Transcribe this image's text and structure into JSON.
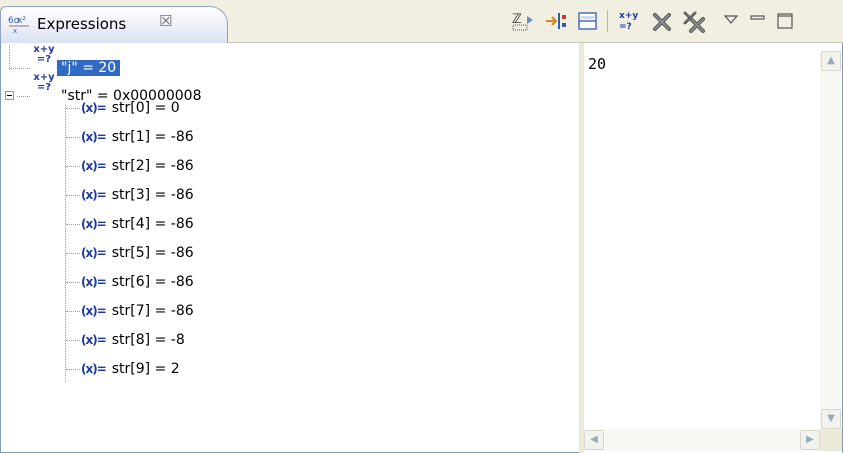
{
  "view": {
    "title": "Expressions",
    "close_glyph": "☒"
  },
  "toolbar": {
    "icons": [
      "show-type-names-icon",
      "collapse-all-icon",
      "layout-icon",
      "add-watch-expression-icon",
      "remove-expression-icon",
      "remove-all-expressions-icon",
      "view-menu-icon",
      "minimize-icon",
      "maximize-icon"
    ]
  },
  "tree": {
    "expressions": [
      {
        "label": "\"j\" = 20",
        "selected": true
      },
      {
        "label": "\"str\" = 0x00000008",
        "expanded": true,
        "children": [
          "str[0] = 0",
          "str[1] = -86",
          "str[2] = -86",
          "str[3] = -86",
          "str[4] = -86",
          "str[5] = -86",
          "str[6] = -86",
          "str[7] = -86",
          "str[8] = -8",
          "str[9] = 2"
        ]
      }
    ],
    "expr_icon_text": "x+y\n=?",
    "var_icon_text": "(x)="
  },
  "detail": {
    "value": "20"
  },
  "colors": {
    "selection": "#316ac5",
    "header_bg": "#f1efe2",
    "icon_blue": "#1e3a9e"
  }
}
